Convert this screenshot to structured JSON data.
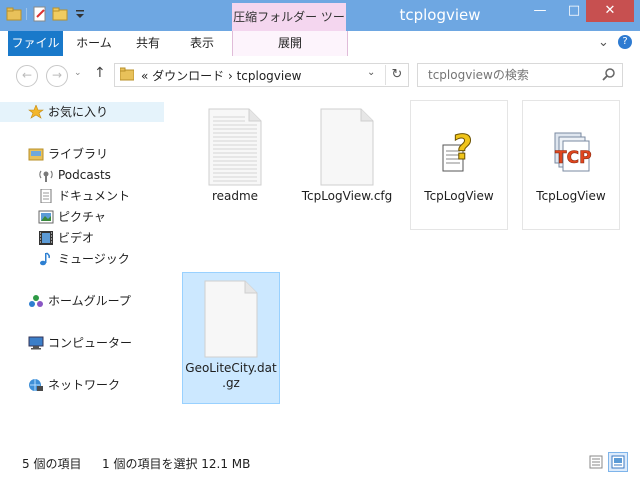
{
  "window": {
    "title": "tcplogview",
    "context_tab_group": "圧縮フォルダー ツール",
    "minimize": "—",
    "maximize": "□",
    "close": "✕"
  },
  "ribbon": {
    "tabs": [
      "ファイル",
      "ホーム",
      "共有",
      "表示",
      "展開"
    ],
    "collapse_glyph": "⌄",
    "help_glyph": "?"
  },
  "navigation": {
    "back_glyph": "←",
    "forward_glyph": "→",
    "recent_glyph": "⌄",
    "up_glyph": "↑"
  },
  "address_bar": {
    "text": "«  ダウンロード  ›  tcplogview",
    "dropdown_glyph": "⌄",
    "refresh_glyph": "↻"
  },
  "search": {
    "placeholder": "tcplogviewの検索"
  },
  "sidebar": {
    "favorites": "お気に入り",
    "library": "ライブラリ",
    "library_items": [
      "Podcasts",
      "ドキュメント",
      "ピクチャ",
      "ビデオ",
      "ミュージック"
    ],
    "homegroup": "ホームグループ",
    "computer": "コンピューター",
    "network": "ネットワーク"
  },
  "files": [
    {
      "name": "readme",
      "type": "text-document"
    },
    {
      "name": "TcpLogView.cfg",
      "type": "blank-document"
    },
    {
      "name": "TcpLogView",
      "type": "help-document"
    },
    {
      "name": "TcpLogView",
      "type": "application"
    },
    {
      "name_line1": "GeoLiteCity.dat",
      "name_line2": ".gz",
      "type": "blank-document",
      "selected": true
    }
  ],
  "status": {
    "item_count": "5 個の項目",
    "selection": "1 個の項目を選択  12.1 MB"
  },
  "colors": {
    "file_tab": "#1979ca",
    "context_tab": "#f4d6ef",
    "titlebar": "#6ea7e2",
    "selection_fill": "#cce8ff",
    "selection_border": "#99d1ff"
  }
}
